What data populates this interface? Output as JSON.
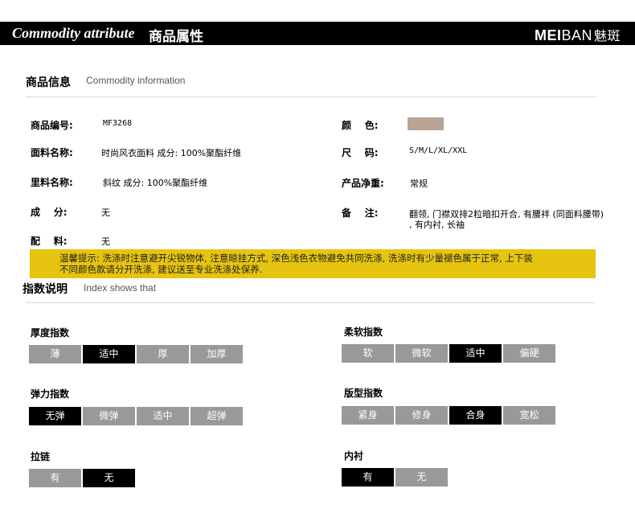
{
  "banner": {
    "title_en": "Commodity attribute",
    "title_zh": "商品属性",
    "brand_bold": "MEI",
    "brand_light": "BAN",
    "brand_cn": "魅斑"
  },
  "info_section": {
    "title": "商品信息",
    "subtitle": "Commodity information"
  },
  "attributes": {
    "item_no": {
      "label": "商品编号:",
      "value": "MF3268"
    },
    "fabric": {
      "label": "面料名称:",
      "value": "时尚风衣面料 成分: 100%聚酯纤维"
    },
    "lining": {
      "label": "里料名称:",
      "value": "斜纹 成分: 100%聚酯纤维"
    },
    "composition": {
      "label": "成    分:",
      "value": "无"
    },
    "accessory": {
      "label": "配    料:",
      "value": "无"
    },
    "color": {
      "label": "颜    色:",
      "swatch": "#b8a395"
    },
    "size": {
      "label": "尺    码:",
      "value": "S/M/L/XL/XXL"
    },
    "net_weight": {
      "label": "产品净重:",
      "value": "常规"
    },
    "note": {
      "label": "备    注:",
      "value_line1": "翻领, 门襟双排2粒暗扣开合, 有腰袢 (同面料腰带)",
      "value_line2": ", 有内衬, 长袖"
    }
  },
  "notice": {
    "line1": "温馨提示: 洗涤时注意避开尖锐物体, 注意晾挂方式, 深色浅色衣物避免共同洗涤, 洗涤时有少量褪色属于正常, 上下装",
    "line2": "不同颜色款请分开洗涤, 建议送至专业洗涤处保养."
  },
  "index_section": {
    "title": "指数说明",
    "subtitle": "Index shows that"
  },
  "indexes": {
    "thickness": {
      "title": "厚度指数",
      "options": [
        "薄",
        "适中",
        "厚",
        "加厚"
      ],
      "selected": "适中"
    },
    "softness": {
      "title": "柔软指数",
      "options": [
        "软",
        "微软",
        "适中",
        "偏硬"
      ],
      "selected": "适中"
    },
    "elasticity": {
      "title": "弹力指数",
      "options": [
        "无弹",
        "微弹",
        "适中",
        "超弹"
      ],
      "selected": "无弹"
    },
    "fit": {
      "title": "版型指数",
      "options": [
        "紧身",
        "修身",
        "合身",
        "宽松"
      ],
      "selected": "合身"
    },
    "zipper": {
      "title": "拉链",
      "options": [
        "有",
        "无"
      ],
      "selected": "无"
    },
    "lining": {
      "title": "内衬",
      "options": [
        "有",
        "无"
      ],
      "selected": "有"
    }
  },
  "colors": {
    "selected": "#000000",
    "unselected": "#999999",
    "notice_bg": "#e6c40f"
  }
}
